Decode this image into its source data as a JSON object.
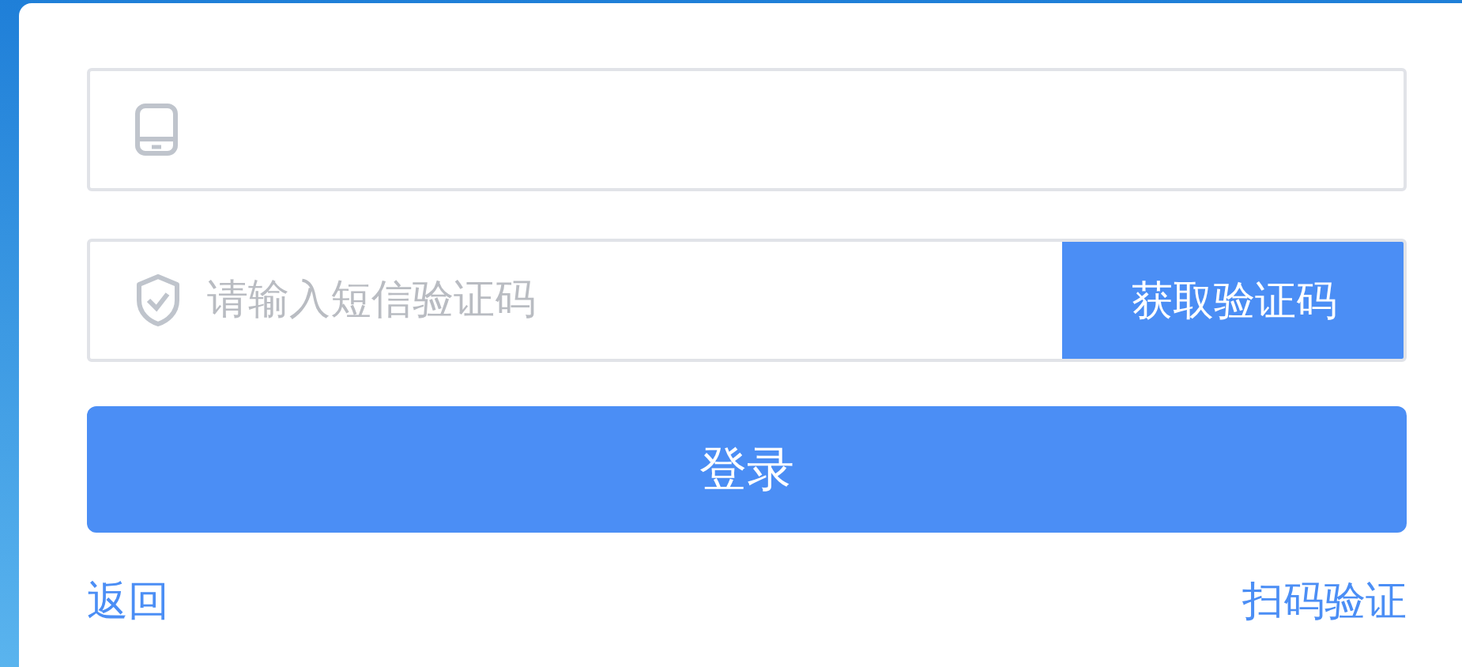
{
  "code_field": {
    "placeholder": "请输入短信验证码"
  },
  "get_code_button": {
    "label": "获取验证码"
  },
  "login_button": {
    "label": "登录"
  },
  "back_link": {
    "label": "返回"
  },
  "scan_link": {
    "label": "扫码验证"
  }
}
